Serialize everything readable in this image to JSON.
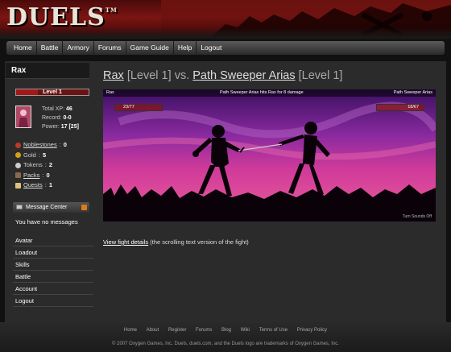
{
  "header": {
    "logo": "DUELS",
    "trademark": "TM"
  },
  "nav": [
    "Home",
    "Battle",
    "Armory",
    "Forums",
    "Game Guide",
    "Help",
    "Logout"
  ],
  "character": {
    "name": "Rax",
    "level_label": "Level 1",
    "xp_progress": 0.3,
    "stats": {
      "total_xp_label": "Total XP:",
      "total_xp": "46",
      "record_label": "Record:",
      "record": "0-0",
      "power_label": "Power:",
      "power": "17 [25]"
    }
  },
  "resources": [
    {
      "label": "Noblestones",
      "value": "0",
      "linked": true,
      "icon": "noblestone-icon",
      "color": "#c0392b"
    },
    {
      "label": "Gold",
      "value": "5",
      "linked": false,
      "icon": "gold-icon",
      "color": "#d4a017"
    },
    {
      "label": "Tokens",
      "value": "2",
      "linked": false,
      "icon": "token-icon",
      "color": "#cccccc"
    },
    {
      "label": "Packs",
      "value": "0",
      "linked": true,
      "icon": "pack-icon",
      "color": "#8a6a4a"
    },
    {
      "label": "Quests",
      "value": "1",
      "linked": true,
      "icon": "quest-icon",
      "color": "#e0c080"
    }
  ],
  "message_center": {
    "title": "Message Center",
    "empty_text": "You have no messages"
  },
  "side_links": [
    "Avatar",
    "Loadout",
    "Skills",
    "Battle",
    "Account",
    "Logout"
  ],
  "duel": {
    "player": "Rax",
    "player_level": "[Level 1]",
    "vs": "vs.",
    "opponent": "Path Sweeper Arias",
    "opponent_level": "[Level 1]"
  },
  "fight": {
    "left_name": "Rax",
    "left_hp": "23/77",
    "left_hp_fraction": 0.3,
    "message": "Path Sweeper Arias hits Rax for 8 damage",
    "right_name": "Path Sweeper Arias",
    "right_hp": "18/67",
    "right_hp_fraction": 0.27,
    "sounds": "Turn Sounds Off"
  },
  "fight_details": {
    "link": "View fight details",
    "note": "(the scrolling text version of the fight)"
  },
  "footer": {
    "links": [
      "Home",
      "About",
      "Register",
      "Forums",
      "Blog",
      "Wiki",
      "Terms of Use",
      "Privacy Policy"
    ],
    "copyright": "© 2007 Oxygen Games, Inc.  Duels, duels.com, and the Duels logo are trademarks of Oxygen Games, Inc."
  }
}
